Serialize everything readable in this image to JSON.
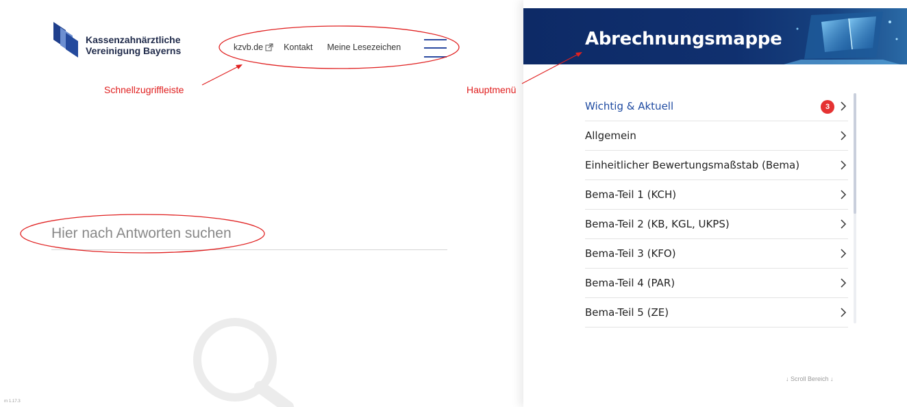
{
  "brand": {
    "line1": "Kassenzahnärztliche",
    "line2": "Vereinigung Bayerns"
  },
  "quickbar": {
    "link_kzvb": "kzvb.de",
    "link_kontakt": "Kontakt",
    "link_bookmarks": "Meine Lesezeichen"
  },
  "annotations": {
    "quickbar": "Schnellzugriffleiste",
    "mainmenu": "Hauptmenü"
  },
  "search": {
    "placeholder": "Hier nach Antworten suchen"
  },
  "version": "rn 1.17.3",
  "banner": {
    "title": "Abrechnungsmappe"
  },
  "menu": {
    "items": [
      {
        "label": "Wichtig & Aktuell",
        "badge": "3"
      },
      {
        "label": "Allgemein"
      },
      {
        "label": "Einheitlicher Bewertungsmaßstab (Bema)"
      },
      {
        "label": "Bema-Teil 1 (KCH)"
      },
      {
        "label": "Bema-Teil 2 (KB, KGL, UKPS)"
      },
      {
        "label": "Bema-Teil 3 (KFO)"
      },
      {
        "label": "Bema-Teil 4 (PAR)"
      },
      {
        "label": "Bema-Teil 5 (ZE)"
      }
    ],
    "scroll_hint": "↓  Scroll Bereich  ↓"
  },
  "colors": {
    "brand_blue": "#1e4aa1",
    "banner_navy": "#0d2a66",
    "annotation_red": "#e02020",
    "badge_red": "#e53232"
  },
  "icons": {
    "external_link": "external-link-icon",
    "menu": "hamburger-menu-icon",
    "chevron": "chevron-right-icon",
    "search_bg": "magnifier-icon"
  }
}
